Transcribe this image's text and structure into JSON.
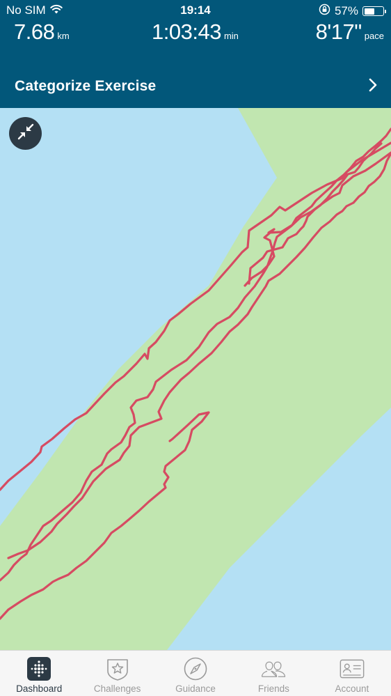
{
  "status_bar": {
    "carrier": "No SIM",
    "time": "19:14",
    "battery_percent": "57%",
    "battery_level": 0.57
  },
  "stats": {
    "distance": {
      "value": "7.68",
      "unit": "km"
    },
    "duration": {
      "value": "1:03:43",
      "unit": "min"
    },
    "pace": {
      "value": "8'17\"",
      "unit": "pace"
    }
  },
  "categorize": {
    "label": "Categorize Exercise",
    "icon": "chevron-right-icon"
  },
  "map": {
    "collapse_icon": "collapse-arrows-icon",
    "colors": {
      "water": "#b4e0f4",
      "land": "#c1e6b0",
      "route": "#d64b62"
    }
  },
  "tab_bar": {
    "tabs": [
      {
        "label": "Dashboard",
        "icon": "dashboard-dots-icon",
        "active": true
      },
      {
        "label": "Challenges",
        "icon": "star-badge-icon",
        "active": false
      },
      {
        "label": "Guidance",
        "icon": "compass-icon",
        "active": false
      },
      {
        "label": "Friends",
        "icon": "friends-icon",
        "active": false
      },
      {
        "label": "Account",
        "icon": "id-card-icon",
        "active": false
      }
    ]
  },
  "colors": {
    "header_bg": "#02577a",
    "tab_active": "#2c3a45",
    "tab_inactive": "#9a9a9a"
  }
}
